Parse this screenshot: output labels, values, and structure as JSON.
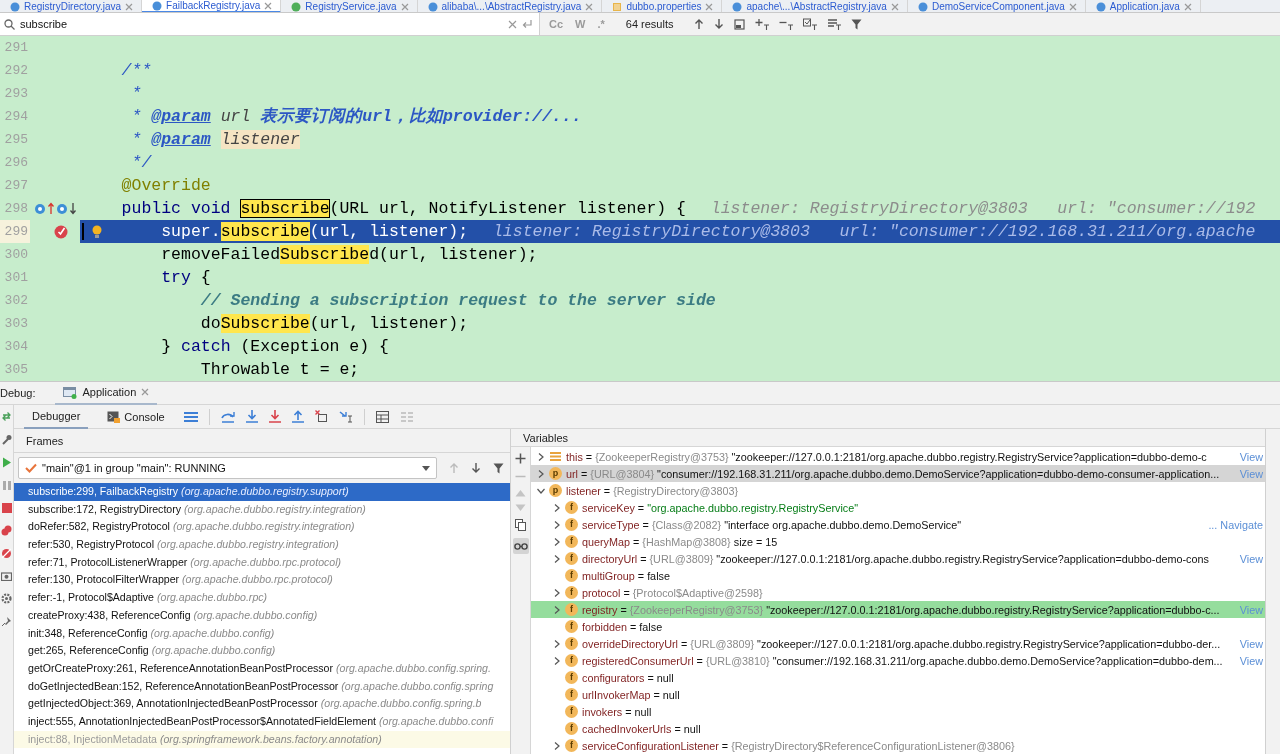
{
  "editor_tabs": [
    {
      "label": "RegistryDirectory.java",
      "kind": "class",
      "selected": false
    },
    {
      "label": "FailbackRegistry.java",
      "kind": "class",
      "selected": true
    },
    {
      "label": "RegistryService.java",
      "kind": "interface",
      "selected": false
    },
    {
      "label": "alibaba\\...\\AbstractRegistry.java",
      "kind": "class",
      "selected": false
    },
    {
      "label": "dubbo.properties",
      "kind": "properties",
      "selected": false
    },
    {
      "label": "apache\\...\\AbstractRegistry.java",
      "kind": "class",
      "selected": false
    },
    {
      "label": "DemoServiceComponent.java",
      "kind": "class",
      "selected": false
    },
    {
      "label": "Application.java",
      "kind": "class",
      "selected": false
    }
  ],
  "find_bar": {
    "query": "subscribe",
    "options": [
      {
        "label": "Cc",
        "on": false
      },
      {
        "label": "W",
        "on": false
      },
      {
        "label": ".*",
        "on": false
      }
    ],
    "results": "64 results"
  },
  "editor": {
    "lines": [
      {
        "number": "291",
        "current": false
      },
      {
        "number": "292",
        "current": false,
        "tokens": [
          {
            "kind": "doc",
            "text": "    /**"
          }
        ]
      },
      {
        "number": "293",
        "current": false,
        "tokens": [
          {
            "kind": "doc",
            "text": "     *"
          }
        ]
      },
      {
        "number": "294",
        "current": false,
        "tokens": [
          {
            "kind": "doc",
            "text": "     * "
          },
          {
            "kind": "doc-tag",
            "text": "@param"
          },
          {
            "kind": "doc-param",
            "text": " url "
          },
          {
            "kind": "doc-text",
            "text": "表示要订阅的url，比如provider://..."
          }
        ]
      },
      {
        "number": "295",
        "current": false,
        "tokens": [
          {
            "kind": "doc",
            "text": "     * "
          },
          {
            "kind": "doc-tag",
            "text": "@param"
          },
          {
            "kind": "doc-param-ref",
            "text": "listener"
          }
        ]
      },
      {
        "number": "296",
        "current": false,
        "tokens": [
          {
            "kind": "doc",
            "text": "     */"
          }
        ]
      },
      {
        "number": "297",
        "current": false,
        "tokens": [
          {
            "kind": "annotation",
            "text": "    @Override"
          }
        ]
      },
      {
        "number": "298",
        "current": false,
        "implemented": true,
        "breakpoint": false,
        "tokens": [
          {
            "kind": "keyword",
            "text": "    public void "
          },
          {
            "kind": "current-match",
            "text": "subscribe"
          },
          {
            "kind": "plain",
            "text": "(URL url, NotifyListener listener) {"
          },
          {
            "kind": "hint",
            "text": "listener: RegistryDirectory@3803   url: \"consumer://192"
          }
        ]
      },
      {
        "number": "299",
        "current": true,
        "implemented": false,
        "breakpoint": true,
        "tokens": [
          {
            "kind": "plain",
            "text": "        super."
          },
          {
            "kind": "match",
            "text": "subscribe"
          },
          {
            "kind": "plain",
            "text": "(url, listener);"
          },
          {
            "kind": "hint",
            "text": "listener: RegistryDirectory@3803   url: \"consumer://192.168.31.211/org.apache"
          }
        ]
      },
      {
        "number": "300",
        "current": false,
        "tokens": [
          {
            "kind": "plain",
            "text": "        removeFailed"
          },
          {
            "kind": "match",
            "text": "Subscribe"
          },
          {
            "kind": "plain",
            "text": "d(url, listener);"
          }
        ]
      },
      {
        "number": "301",
        "current": false,
        "tokens": [
          {
            "kind": "keyword",
            "text": "        try"
          },
          {
            "kind": "plain",
            "text": " {"
          }
        ]
      },
      {
        "number": "302",
        "current": false,
        "tokens": [
          {
            "kind": "comment",
            "text": "            // Sending a subscription request to the server side"
          }
        ]
      },
      {
        "number": "303",
        "current": false,
        "tokens": [
          {
            "kind": "plain",
            "text": "            do"
          },
          {
            "kind": "match",
            "text": "Subscribe"
          },
          {
            "kind": "plain",
            "text": "(url, listener);"
          }
        ]
      },
      {
        "number": "304",
        "current": false,
        "tokens": [
          {
            "kind": "plain",
            "text": "        } "
          },
          {
            "kind": "keyword",
            "text": "catch"
          },
          {
            "kind": "plain",
            "text": " (Exception e) {"
          }
        ]
      },
      {
        "number": "305",
        "current": false,
        "tokens": [
          {
            "kind": "plain",
            "text": "            Throwable t = e;"
          }
        ]
      }
    ]
  },
  "debug": {
    "label": "Debug:",
    "session": "Application",
    "tabs": [
      {
        "label": "Debugger",
        "selected": true
      },
      {
        "label": "Console",
        "selected": false
      }
    ],
    "frames": {
      "title": "Frames",
      "thread": "\"main\"@1 in group \"main\": RUNNING",
      "items": [
        {
          "method": "subscribe:299, FailbackRegistry",
          "package": "(org.apache.dubbo.registry.support)",
          "selected": true,
          "library": false
        },
        {
          "method": "subscribe:172, RegistryDirectory",
          "package": "(org.apache.dubbo.registry.integration)",
          "selected": false,
          "library": false
        },
        {
          "method": "doRefer:582, RegistryProtocol",
          "package": "(org.apache.dubbo.registry.integration)",
          "selected": false,
          "library": false
        },
        {
          "method": "refer:530, RegistryProtocol",
          "package": "(org.apache.dubbo.registry.integration)",
          "selected": false,
          "library": false
        },
        {
          "method": "refer:71, ProtocolListenerWrapper",
          "package": "(org.apache.dubbo.rpc.protocol)",
          "selected": false,
          "library": false
        },
        {
          "method": "refer:130, ProtocolFilterWrapper",
          "package": "(org.apache.dubbo.rpc.protocol)",
          "selected": false,
          "library": false
        },
        {
          "method": "refer:-1, Protocol$Adaptive",
          "package": "(org.apache.dubbo.rpc)",
          "selected": false,
          "library": false
        },
        {
          "method": "createProxy:438, ReferenceConfig",
          "package": "(org.apache.dubbo.config)",
          "selected": false,
          "library": false
        },
        {
          "method": "init:348, ReferenceConfig",
          "package": "(org.apache.dubbo.config)",
          "selected": false,
          "library": false
        },
        {
          "method": "get:265, ReferenceConfig",
          "package": "(org.apache.dubbo.config)",
          "selected": false,
          "library": false
        },
        {
          "method": "getOrCreateProxy:261, ReferenceAnnotationBeanPostProcessor",
          "package": "(org.apache.dubbo.config.spring.",
          "selected": false,
          "library": false
        },
        {
          "method": "doGetInjectedBean:152, ReferenceAnnotationBeanPostProcessor",
          "package": "(org.apache.dubbo.config.spring",
          "selected": false,
          "library": false
        },
        {
          "method": "getInjectedObject:369, AnnotationInjectedBeanPostProcessor",
          "package": "(org.apache.dubbo.config.spring.b",
          "selected": false,
          "library": false
        },
        {
          "method": "inject:555, AnnotationInjectedBeanPostProcessor$AnnotatedFieldElement",
          "package": "(org.apache.dubbo.confi",
          "selected": false,
          "library": false
        },
        {
          "method": "inject:88, InjectionMetadata",
          "package": "(org.springframework.beans.factory.annotation)",
          "selected": false,
          "library": true
        }
      ]
    },
    "variables": {
      "title": "Variables",
      "items": [
        {
          "kind": "object",
          "name": "this",
          "operator": "=",
          "type": "{ZookeeperRegistry@3753}",
          "value": "\"zookeeper://127.0.0.1:2181/org.apache.dubbo.registry.RegistryService?application=dubbo-demo-c",
          "link": "View",
          "expandable": true,
          "expanded": false,
          "selected": false,
          "highlighted": false
        },
        {
          "kind": "param",
          "badge": "p",
          "name": "url",
          "operator": "=",
          "type": "{URL@3804}",
          "value": "\"consumer://192.168.31.211/org.apache.dubbo.demo.DemoService?application=dubbo-demo-consumer-application...",
          "link": "View",
          "expandable": true,
          "expanded": false,
          "selected": true,
          "highlighted": false
        },
        {
          "kind": "param",
          "badge": "p",
          "name": "listener",
          "operator": "=",
          "type": "{RegistryDirectory@3803}",
          "expandable": true,
          "expanded": true,
          "selected": false,
          "highlighted": false,
          "children": [
            {
              "kind": "field",
              "badge": "f",
              "name": "serviceKey",
              "operator": "=",
              "value": "\"org.apache.dubbo.registry.RegistryService\"",
              "is_string": true,
              "expandable": true,
              "expanded": false,
              "selected": false,
              "highlighted": false
            },
            {
              "kind": "field",
              "badge": "f",
              "name": "serviceType",
              "operator": "=",
              "type": "{Class@2082}",
              "value": "\"interface org.apache.dubbo.demo.DemoService\"",
              "link": "... Navigate",
              "expandable": true,
              "expanded": false,
              "selected": false,
              "highlighted": false
            },
            {
              "kind": "field",
              "badge": "f",
              "name": "queryMap",
              "operator": "=",
              "type": "{HashMap@3808}",
              "value": "size = 15",
              "expandable": true,
              "expanded": false,
              "selected": false,
              "highlighted": false
            },
            {
              "kind": "field",
              "badge": "f",
              "name": "directoryUrl",
              "operator": "=",
              "type": "{URL@3809}",
              "value": "\"zookeeper://127.0.0.1:2181/org.apache.dubbo.registry.RegistryService?application=dubbo-demo-cons",
              "link": "View",
              "expandable": true,
              "expanded": false,
              "selected": false,
              "highlighted": false
            },
            {
              "kind": "field",
              "badge": "f",
              "name": "multiGroup",
              "operator": "=",
              "value": "false",
              "expandable": false,
              "selected": false,
              "highlighted": false
            },
            {
              "kind": "field",
              "badge": "f",
              "name": "protocol",
              "operator": "=",
              "type": "{Protocol$Adaptive@2598}",
              "expandable": true,
              "expanded": false,
              "selected": false,
              "highlighted": false
            },
            {
              "kind": "field",
              "badge": "f",
              "name": "registry",
              "operator": "=",
              "type": "{ZookeeperRegistry@3753}",
              "value": "\"zookeeper://127.0.0.1:2181/org.apache.dubbo.registry.RegistryService?application=dubbo-c...",
              "link": "View",
              "expandable": true,
              "expanded": false,
              "selected": false,
              "highlighted": true
            },
            {
              "kind": "field",
              "badge": "f",
              "name": "forbidden",
              "operator": "=",
              "value": "false",
              "expandable": false,
              "selected": false,
              "highlighted": false
            },
            {
              "kind": "field",
              "badge": "f",
              "name": "overrideDirectoryUrl",
              "operator": "=",
              "type": "{URL@3809}",
              "value": "\"zookeeper://127.0.0.1:2181/org.apache.dubbo.registry.RegistryService?application=dubbo-der...",
              "link": "View",
              "expandable": true,
              "expanded": false,
              "selected": false,
              "highlighted": false
            },
            {
              "kind": "field",
              "badge": "f",
              "name": "registeredConsumerUrl",
              "operator": "=",
              "type": "{URL@3810}",
              "value": "\"consumer://192.168.31.211/org.apache.dubbo.demo.DemoService?application=dubbo-dem...",
              "link": "View",
              "expandable": true,
              "expanded": false,
              "selected": false,
              "highlighted": false
            },
            {
              "kind": "field",
              "badge": "f",
              "name": "configurators",
              "operator": "=",
              "value": "null",
              "expandable": false,
              "selected": false,
              "highlighted": false
            },
            {
              "kind": "field",
              "badge": "f",
              "name": "urlInvokerMap",
              "operator": "=",
              "value": "null",
              "expandable": false,
              "selected": false,
              "highlighted": false
            },
            {
              "kind": "field",
              "badge": "f",
              "name": "invokers",
              "operator": "=",
              "value": "null",
              "expandable": false,
              "selected": false,
              "highlighted": false
            },
            {
              "kind": "field",
              "badge": "f",
              "name": "cachedInvokerUrls",
              "operator": "=",
              "value": "null",
              "expandable": false,
              "selected": false,
              "highlighted": false
            },
            {
              "kind": "field",
              "badge": "f",
              "name": "serviceConfigurationListener",
              "operator": "=",
              "type": "{RegistryDirectory$ReferenceConfigurationListener@3806}",
              "expandable": true,
              "expanded": false,
              "selected": false,
              "highlighted": false
            }
          ]
        }
      ]
    }
  }
}
